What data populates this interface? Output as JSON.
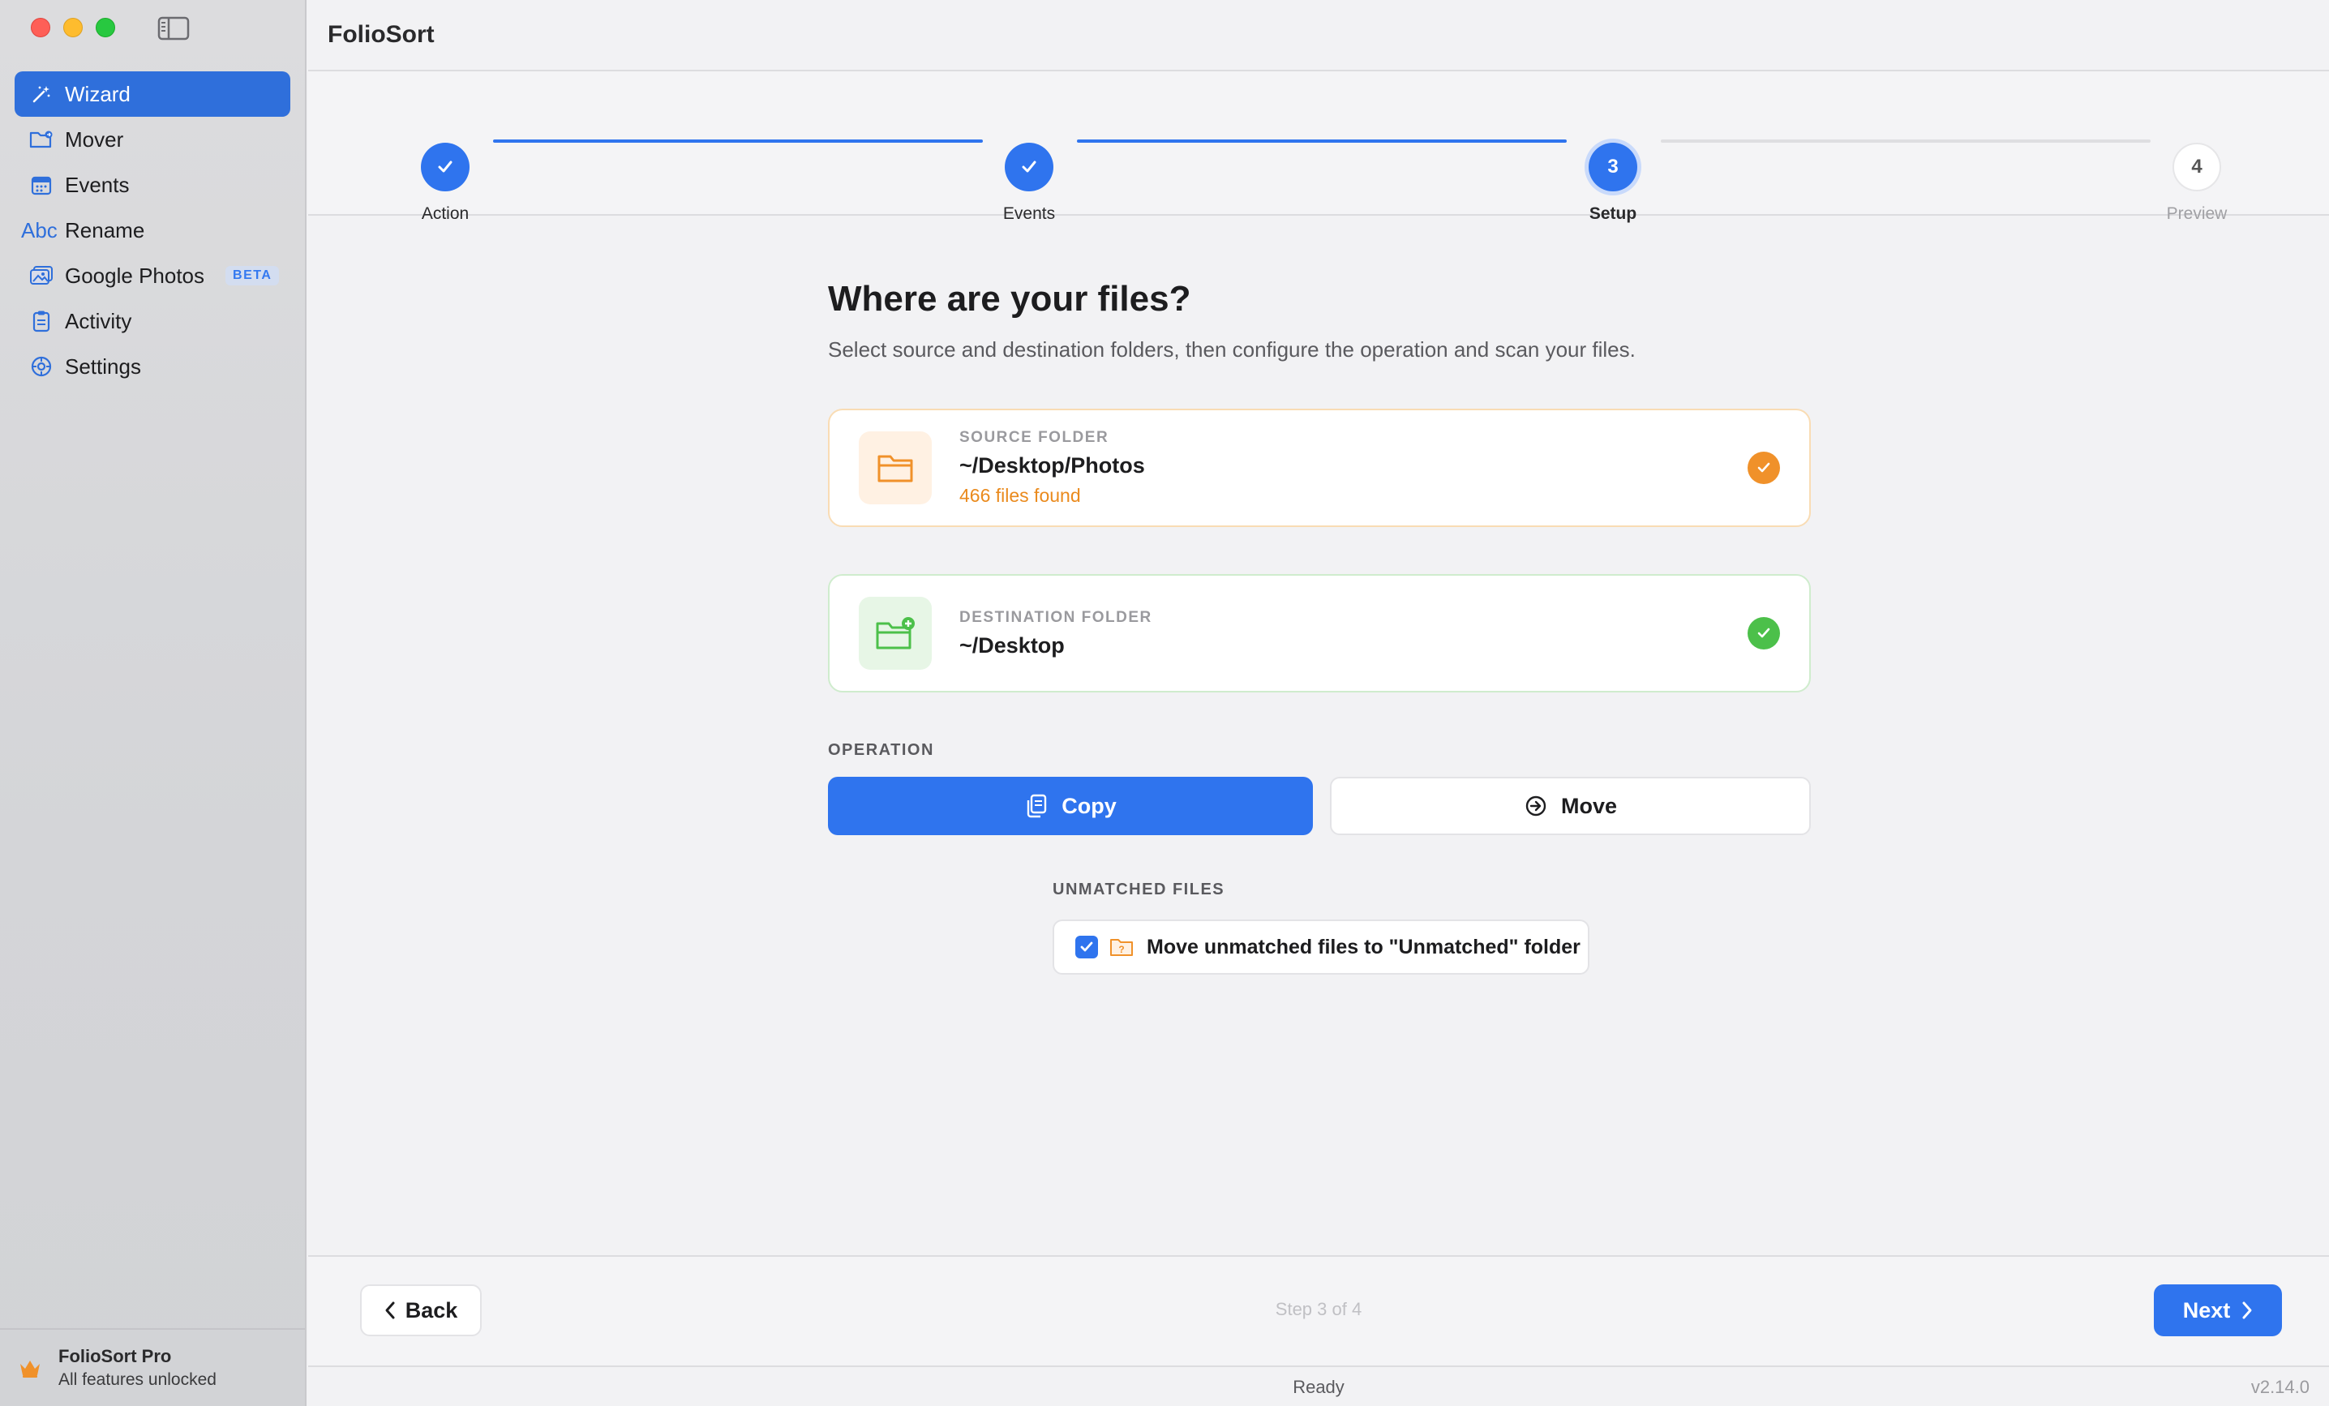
{
  "app": {
    "title": "FolioSort",
    "version": "v2.14.0",
    "status": "Ready"
  },
  "sidebar": {
    "items": [
      {
        "label": "Wizard",
        "icon": "magic-wand-icon",
        "active": true
      },
      {
        "label": "Mover",
        "icon": "folder-move-icon"
      },
      {
        "label": "Events",
        "icon": "calendar-icon"
      },
      {
        "label": "Rename",
        "icon": "abc-text-icon",
        "prefix": "Abc"
      },
      {
        "label": "Google Photos",
        "icon": "photos-icon",
        "badge": "BETA"
      },
      {
        "label": "Activity",
        "icon": "clipboard-icon"
      },
      {
        "label": "Settings",
        "icon": "gear-icon"
      }
    ],
    "pro": {
      "title": "FolioSort Pro",
      "subtitle": "All features unlocked",
      "icon": "crown-icon"
    }
  },
  "stepper": {
    "steps": [
      {
        "label": "Action",
        "state": "done"
      },
      {
        "label": "Events",
        "state": "done"
      },
      {
        "label": "Setup",
        "number": "3",
        "state": "current"
      },
      {
        "label": "Preview",
        "number": "4",
        "state": "todo"
      }
    ]
  },
  "setup": {
    "heading": "Where are your files?",
    "subheading": "Select source and destination folders, then configure the operation and scan your files.",
    "source": {
      "caption": "SOURCE FOLDER",
      "path": "~/Desktop/Photos",
      "found": "466 files found",
      "accent": "#f0912a"
    },
    "destination": {
      "caption": "DESTINATION FOLDER",
      "path": "~/Desktop",
      "accent": "#4cc04a"
    },
    "operation": {
      "label": "OPERATION",
      "copy": "Copy",
      "move": "Move",
      "selected": "Copy"
    },
    "unmatched": {
      "label": "UNMATCHED FILES",
      "option": "Move unmatched files to \"Unmatched\" folder",
      "checked": true
    }
  },
  "footer": {
    "back": "Back",
    "step_counter": "Step 3 of 4",
    "next": "Next"
  },
  "colors": {
    "accent": "#2f74ee",
    "sidebar_active": "#2f6fdb"
  }
}
